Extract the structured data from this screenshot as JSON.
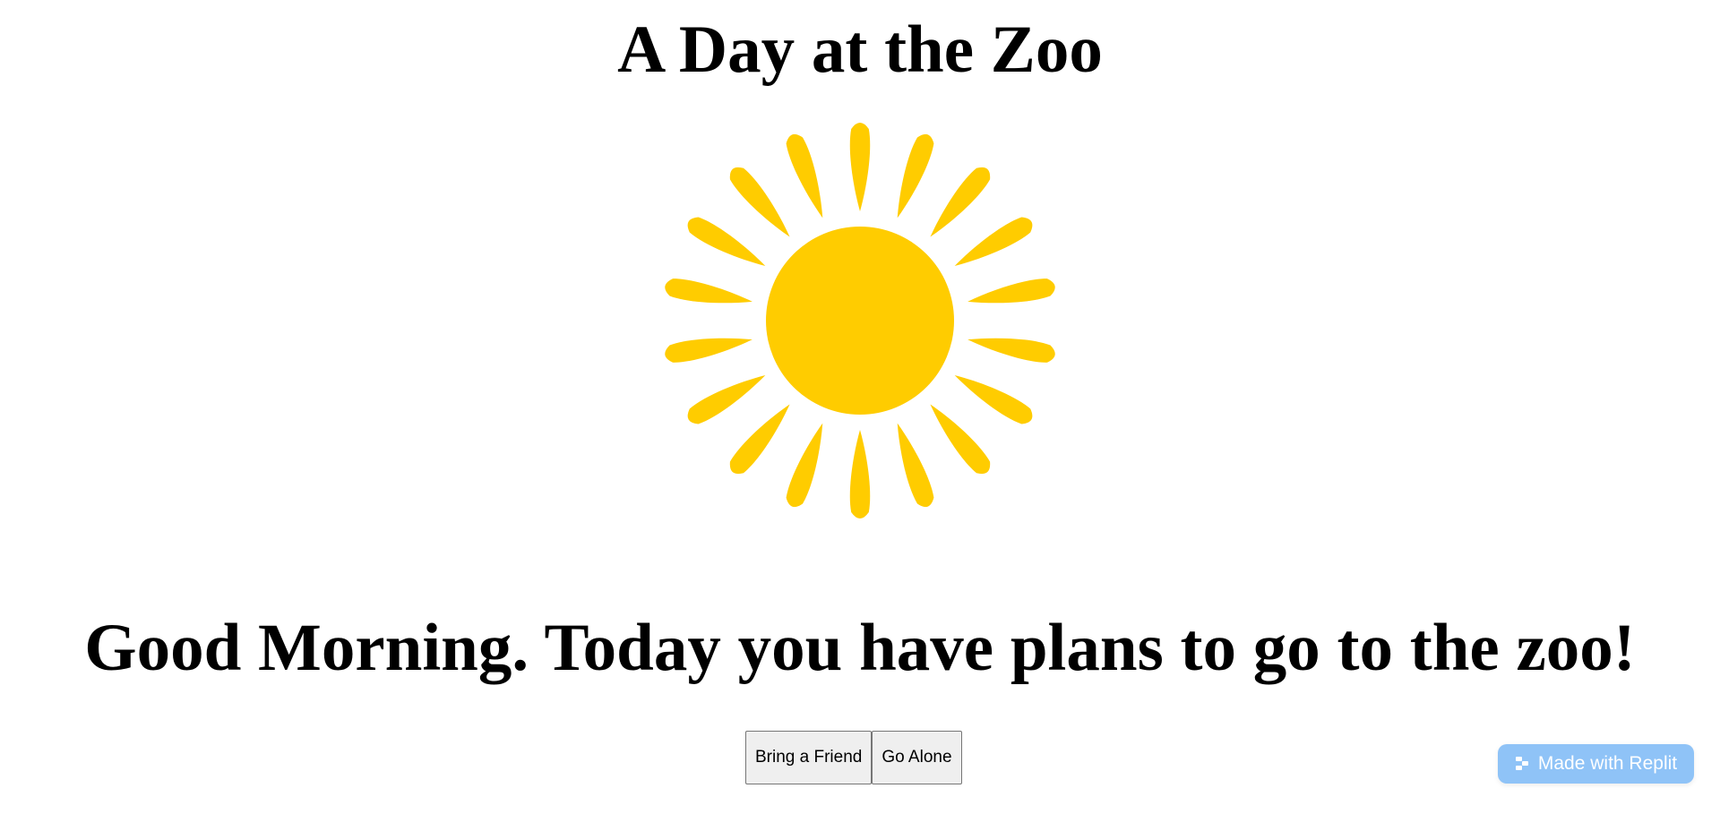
{
  "page": {
    "title": "A Day at the Zoo",
    "headline": "Good Morning. Today you have plans to go to the zoo!"
  },
  "sun": {
    "icon": "sun-icon",
    "color": "#ffcc00"
  },
  "buttons": {
    "bring_friend": "Bring a Friend",
    "go_alone": "Go Alone"
  },
  "badge": {
    "label": "Made with Replit",
    "icon": "replit-icon",
    "color": "#8fc3f7"
  }
}
